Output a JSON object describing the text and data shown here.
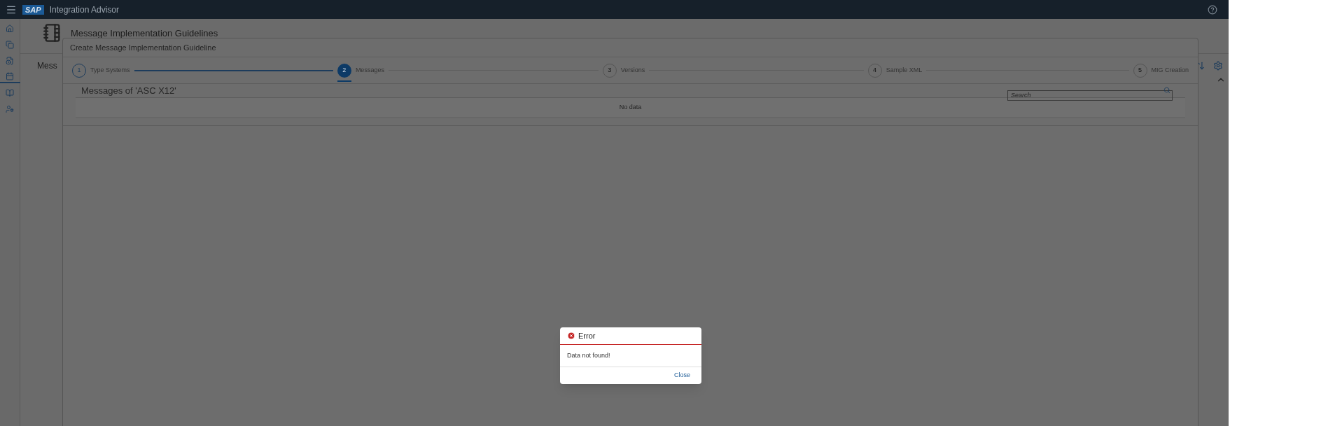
{
  "shell": {
    "brand": "SAP",
    "title": "Integration Advisor"
  },
  "sidebar": {
    "items": [
      {
        "selected": false
      },
      {
        "selected": false
      },
      {
        "selected": false
      },
      {
        "selected": true
      },
      {
        "selected": false
      },
      {
        "selected": false
      }
    ]
  },
  "page": {
    "title": "Message Implementation Guidelines",
    "section_title": "Mess"
  },
  "dialog": {
    "title": "Create Message Implementation Guideline",
    "steps": [
      {
        "number": "1",
        "label": "Type Systems",
        "selected": false,
        "completed": true
      },
      {
        "number": "2",
        "label": "Messages",
        "selected": true,
        "completed": false
      },
      {
        "number": "3",
        "label": "Versions",
        "selected": false,
        "completed": false
      },
      {
        "number": "4",
        "label": "Sample XML",
        "selected": false,
        "completed": false
      },
      {
        "number": "5",
        "label": "MIG Creation",
        "selected": false,
        "completed": false
      }
    ],
    "list_title": "Messages of 'ASC X12'",
    "search": {
      "placeholder": "Search"
    },
    "empty_text": "No data"
  },
  "error": {
    "title": "Error",
    "message": "Data not found!",
    "button": "Close"
  }
}
